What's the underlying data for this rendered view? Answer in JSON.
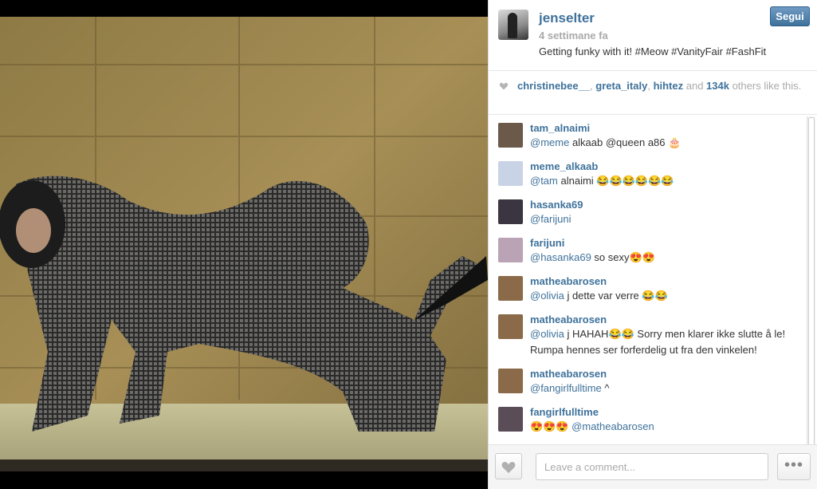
{
  "post": {
    "username": "jenselter",
    "time_ago": "4 settimane fa",
    "caption": "Getting funky with it! #Meow #VanityFair #FashFit",
    "follow_label": "Segui"
  },
  "likes": {
    "users": [
      "christinebee__",
      "greta_italy",
      "hihtez"
    ],
    "sep": ", ",
    "and": " and ",
    "count": "134k",
    "suffix": " others like this."
  },
  "comments": [
    {
      "user": "tam_alnaimi",
      "mention": "@meme",
      "text": "  alkaab @queen   a86 🎂",
      "avatar_color": "#6b5a4a"
    },
    {
      "user": "meme_alkaab",
      "mention": "@tam",
      "text": "  alnaimi 😂😂😂😂😂😂",
      "avatar_color": "#c9d3e6"
    },
    {
      "user": "hasanka69",
      "mention": "@farijuni",
      "text": "",
      "avatar_color": "#3a3540"
    },
    {
      "user": "farijuni",
      "mention": "@hasanka69",
      "text": " so sexy😍😍",
      "avatar_color": "#b9a3b5"
    },
    {
      "user": "matheabarosen",
      "mention": "@olivia",
      "text": "    j dette var verre 😂😂",
      "avatar_color": "#8a6a48"
    },
    {
      "user": "matheabarosen",
      "mention": "@olivia",
      "text": "    j HAHAH😂😂 Sorry men klarer ikke slutte å le! Rumpa hennes ser forferdelig ut fra den vinkelen!",
      "avatar_color": "#8a6a48"
    },
    {
      "user": "matheabarosen",
      "mention": "@fangirlfulltime",
      "text": " ^",
      "avatar_color": "#8a6a48"
    },
    {
      "user": "fangirlfulltime",
      "mention": "@matheabarosen",
      "text": "",
      "prefix": "😍😍😍 ",
      "avatar_color": "#5a4d58"
    }
  ],
  "input": {
    "placeholder": "Leave a comment..."
  },
  "more_label": "•••",
  "colors": {
    "link": "#3f729b",
    "follow": "#3f729b"
  }
}
